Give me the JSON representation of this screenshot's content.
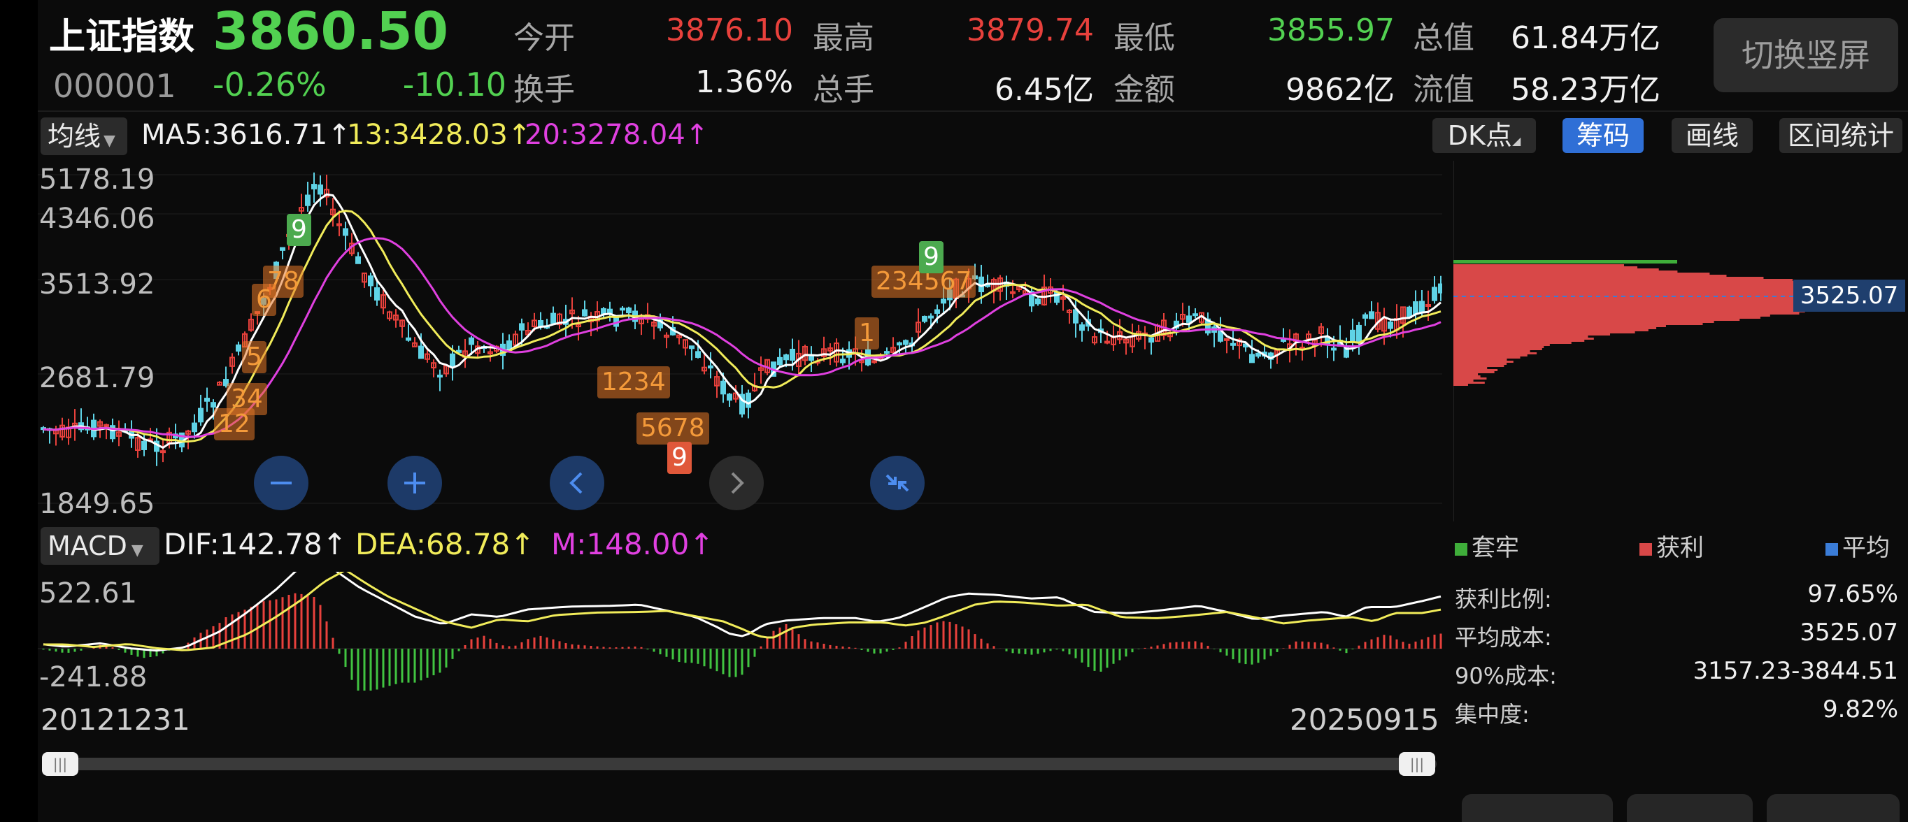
{
  "header": {
    "name": "上证指数",
    "price": "3860.50",
    "code": "000001",
    "change_pct": "-0.26%",
    "change": "-10.10",
    "switch_label": "切换竖屏",
    "stats": [
      {
        "label": "今开",
        "value": "3876.10",
        "color": "#e8413c"
      },
      {
        "label": "最高",
        "value": "3879.74",
        "color": "#e8413c"
      },
      {
        "label": "最低",
        "value": "3855.97",
        "color": "#52d151"
      },
      {
        "label": "总值",
        "value": "61.84万亿",
        "color": "#f2f2f2"
      },
      {
        "label": "换手",
        "value": "1.36%",
        "color": "#f2f2f2"
      },
      {
        "label": "总手",
        "value": "6.45亿",
        "color": "#f2f2f2"
      },
      {
        "label": "金额",
        "value": "9862亿",
        "color": "#f2f2f2"
      },
      {
        "label": "流值",
        "value": "58.23万亿",
        "color": "#f2f2f2"
      }
    ]
  },
  "ma_bar": {
    "indicator": "均线",
    "ma5": "MA5:3616.71↑",
    "ma13": "13:3428.03↑",
    "ma20": "20:3278.04↑",
    "buttons": [
      "DK点",
      "筹码",
      "画线",
      "区间统计"
    ]
  },
  "price_axis": [
    "5178.19",
    "4346.06",
    "3513.92",
    "2681.79",
    "1849.65"
  ],
  "macd_bar": {
    "indicator": "MACD",
    "dif": "DIF:142.78↑",
    "dea": "DEA:68.78↑",
    "m": "M:148.00↑"
  },
  "macd_axis": [
    "522.61",
    "-241.88"
  ],
  "dates": {
    "start": "20121231",
    "end": "20250915"
  },
  "td_labels": [
    {
      "text": "9",
      "kind": "green"
    },
    {
      "text": "78",
      "kind": "orange"
    },
    {
      "text": "6",
      "kind": "orange"
    },
    {
      "text": "5",
      "kind": "orange"
    },
    {
      "text": "34",
      "kind": "orange"
    },
    {
      "text": "12",
      "kind": "orange"
    },
    {
      "text": "1234",
      "kind": "orange"
    },
    {
      "text": "5678",
      "kind": "orange"
    },
    {
      "text": "9",
      "kind": "red"
    },
    {
      "text": "1",
      "kind": "orange"
    },
    {
      "text": "234567",
      "kind": "orange"
    },
    {
      "text": "9",
      "kind": "green"
    }
  ],
  "chip": {
    "price_label": "3525.07",
    "legend": [
      "套牢",
      "获利",
      "平均"
    ],
    "legend_colors": [
      "#3fae3a",
      "#d84848",
      "#3b7dd8"
    ],
    "stats": [
      {
        "label": "获利比例:",
        "value": "97.65%"
      },
      {
        "label": "平均成本:",
        "value": "3525.07"
      },
      {
        "label": "90%成本:",
        "value": "3157.23-3844.51"
      },
      {
        "label": "集中度:",
        "value": "9.82%"
      }
    ]
  },
  "colors": {
    "up": "#e8413c",
    "down": "#5fd3e6",
    "ma5": "#ffffff",
    "ma13": "#f1ec5a",
    "ma20": "#e040e0",
    "accent": "#2f6fd6"
  }
}
